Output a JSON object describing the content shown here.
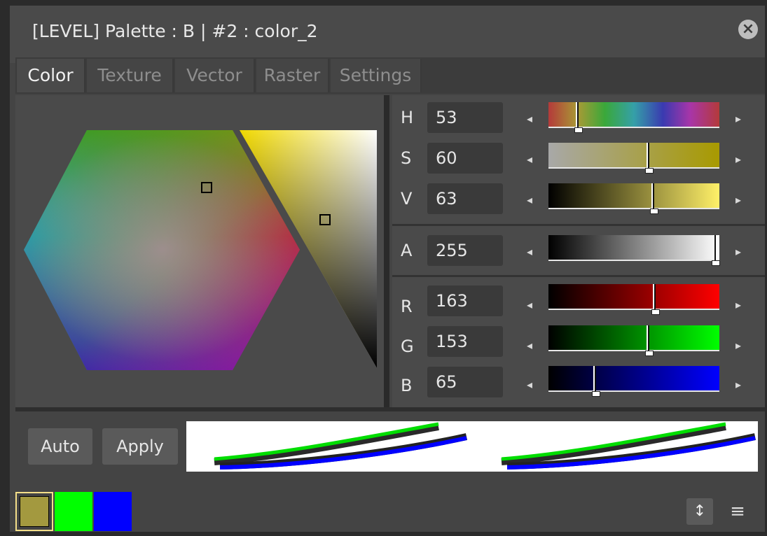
{
  "window": {
    "title": "[LEVEL]  Palette : B | #2 : color_2",
    "close_icon": "close-icon"
  },
  "tabs": [
    {
      "label": "Color",
      "active": true
    },
    {
      "label": "Texture",
      "active": false
    },
    {
      "label": "Vector",
      "active": false
    },
    {
      "label": "Raster",
      "active": false
    },
    {
      "label": "Settings",
      "active": false
    }
  ],
  "channels": {
    "H": {
      "label": "H",
      "value": "53",
      "level": 0.17
    },
    "S": {
      "label": "S",
      "value": "60",
      "level": 0.58
    },
    "V": {
      "label": "V",
      "value": "63",
      "level": 0.61
    },
    "A": {
      "label": "A",
      "value": "255",
      "level": 0.97
    },
    "R": {
      "label": "R",
      "value": "163",
      "level": 0.62
    },
    "G": {
      "label": "G",
      "value": "153",
      "level": 0.58
    },
    "B": {
      "label": "B",
      "value": "65",
      "level": 0.27
    }
  },
  "buttons": {
    "auto": "Auto",
    "apply": "Apply"
  },
  "swatches": [
    "#a3993f",
    "#00ff00",
    "#0000ff"
  ],
  "current_color": "#a39941",
  "icons": {
    "decrement": "triangle-left-icon",
    "increment": "triangle-right-icon",
    "orientation": "vertical-arrows-icon",
    "menu": "hamburger-menu-icon"
  }
}
